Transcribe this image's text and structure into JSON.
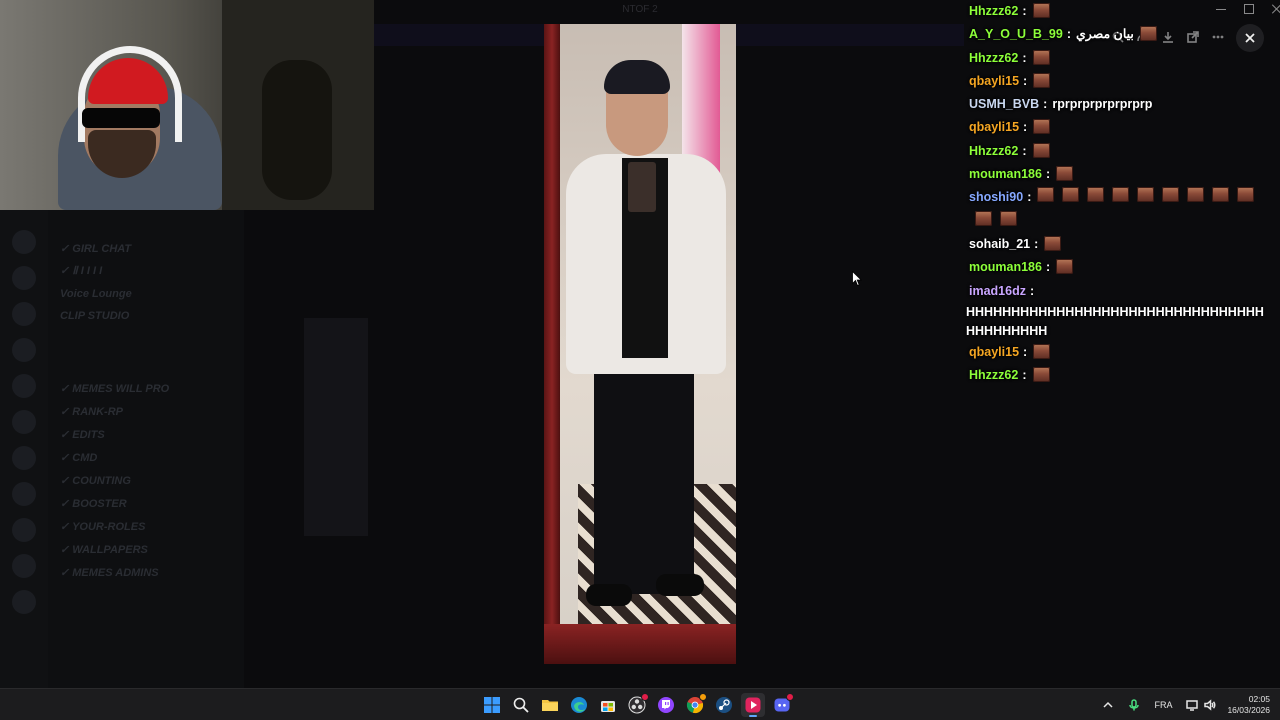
{
  "window": {
    "title": "NTOF 2"
  },
  "chat": {
    "messages": [
      {
        "user": "Hhzzz62",
        "color": "#8dff3a",
        "text": "",
        "emotes": 1
      },
      {
        "user": "A_Y_O_U_B_99",
        "color": "#8dff3a",
        "text": "بيان مصري",
        "emotes": 1
      },
      {
        "user": "Hhzzz62",
        "color": "#8dff3a",
        "text": "",
        "emotes": 1
      },
      {
        "user": "qbayli15",
        "color": "#f5a623",
        "text": "",
        "emotes": 1
      },
      {
        "user": "USMH_BVB",
        "color": "#c9d7f0",
        "text": "rprprprprprprprp",
        "emotes": 0
      },
      {
        "user": "qbayli15",
        "color": "#f5a623",
        "text": "",
        "emotes": 1
      },
      {
        "user": "Hhzzz62",
        "color": "#8dff3a",
        "text": "",
        "emotes": 1
      },
      {
        "user": "mouman186",
        "color": "#8dff3a",
        "text": "",
        "emotes": 1
      },
      {
        "user": "shoshi90",
        "color": "#86a8ff",
        "text": "",
        "emotes": 11
      },
      {
        "user": "sohaib_21",
        "color": "#ffffff",
        "text": "",
        "emotes": 1
      },
      {
        "user": "mouman186",
        "color": "#8dff3a",
        "text": "",
        "emotes": 1
      },
      {
        "user": "imad16dz",
        "color": "#c9a6ff",
        "text": "HHHHHHHHHHHHHHHHHHHHHHHHHHHHHHHHHHHHHHHHHH",
        "emotes": 0
      },
      {
        "user": "qbayli15",
        "color": "#f5a623",
        "text": "",
        "emotes": 1
      },
      {
        "user": "Hhzzz62",
        "color": "#8dff3a",
        "text": "",
        "emotes": 1
      }
    ],
    "separator": ":"
  },
  "underlay": {
    "channels": [
      "✓ GIRL CHAT",
      "✓ Ⅱ I I I I",
      "Voice Lounge",
      "CLIP STUDIO",
      "✓ MEMES WILL PRO",
      "✓ RANK-RP",
      "✓ EDITS",
      "✓ CMD",
      "✓ COUNTING",
      "✓ BOOSTER",
      "✓ YOUR-ROLES",
      "✓ WALLPAPERS",
      "✓ MEMES ADMINS"
    ]
  },
  "taskbar": {
    "apps": [
      {
        "name": "start",
        "icon": "windows-icon"
      },
      {
        "name": "search",
        "icon": "search-icon"
      },
      {
        "name": "file-explorer",
        "icon": "folder-icon"
      },
      {
        "name": "edge",
        "icon": "edge-icon"
      },
      {
        "name": "store",
        "icon": "store-icon"
      },
      {
        "name": "obs",
        "icon": "obs-icon"
      },
      {
        "name": "twitch",
        "icon": "twitch-icon"
      },
      {
        "name": "chrome",
        "icon": "chrome-icon"
      },
      {
        "name": "steam",
        "icon": "steam-icon"
      },
      {
        "name": "media-player",
        "icon": "play-icon"
      },
      {
        "name": "discord",
        "icon": "discord-icon"
      }
    ],
    "tray": {
      "language": "FRA",
      "time": "02:05",
      "date": "16/03/2026"
    }
  }
}
